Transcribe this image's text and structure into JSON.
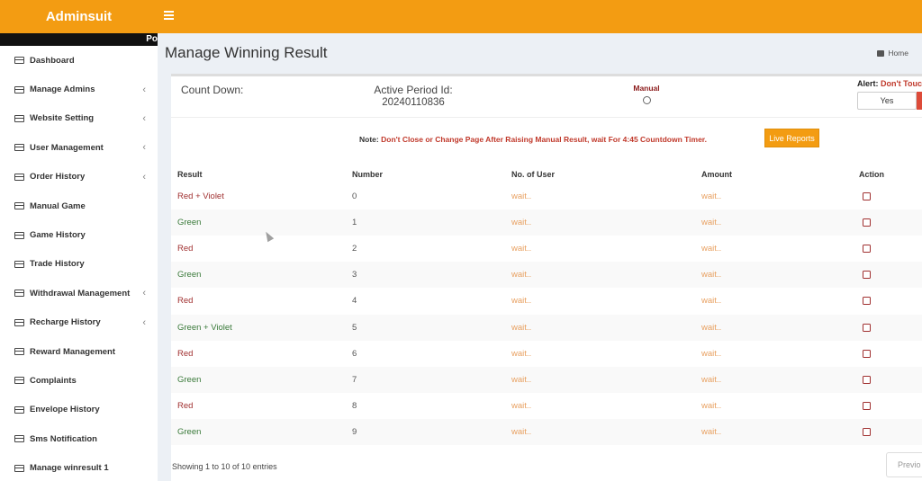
{
  "app": {
    "title": "Adminsuit",
    "sidebar_header_text": "Po"
  },
  "sidebar": {
    "items": [
      {
        "label": "Dashboard",
        "has_submenu": false
      },
      {
        "label": "Manage Admins",
        "has_submenu": true
      },
      {
        "label": "Website Setting",
        "has_submenu": true
      },
      {
        "label": "User Management",
        "has_submenu": true
      },
      {
        "label": "Order History",
        "has_submenu": true
      },
      {
        "label": "Manual Game",
        "has_submenu": false
      },
      {
        "label": "Game History",
        "has_submenu": false
      },
      {
        "label": "Trade History",
        "has_submenu": false
      },
      {
        "label": "Withdrawal Management",
        "has_submenu": true
      },
      {
        "label": "Recharge History",
        "has_submenu": true
      },
      {
        "label": "Reward Management",
        "has_submenu": false
      },
      {
        "label": "Complaints",
        "has_submenu": false
      },
      {
        "label": "Envelope History",
        "has_submenu": false
      },
      {
        "label": "Sms Notification",
        "has_submenu": false
      },
      {
        "label": "Manage winresult 1",
        "has_submenu": false
      }
    ]
  },
  "page": {
    "title": "Manage Winning Result",
    "breadcrumb_home": "Home"
  },
  "panel": {
    "count_down_label": "Count Down:",
    "active_period_label": "Active Period Id:",
    "active_period_value": "20240110836",
    "manual_label": "Manual",
    "alert_prefix": "Alert:",
    "alert_text": "Don't Touc",
    "yes_label": "Yes",
    "note_prefix": "Note:",
    "note_text": "Don't Close or Change Page After Raising Manual Result, wait For 4:45 Countdown Timer.",
    "live_reports_label": "Live Reports"
  },
  "table": {
    "headers": [
      "Result",
      "Number",
      "No. of User",
      "Amount",
      "Action"
    ],
    "rows": [
      {
        "result": "Red + Violet",
        "color": "red",
        "number": "0",
        "users": "wait..",
        "amount": "wait.."
      },
      {
        "result": "Green",
        "color": "green",
        "number": "1",
        "users": "wait..",
        "amount": "wait.."
      },
      {
        "result": "Red",
        "color": "red",
        "number": "2",
        "users": "wait..",
        "amount": "wait.."
      },
      {
        "result": "Green",
        "color": "green",
        "number": "3",
        "users": "wait..",
        "amount": "wait.."
      },
      {
        "result": "Red",
        "color": "red",
        "number": "4",
        "users": "wait..",
        "amount": "wait.."
      },
      {
        "result": "Green + Violet",
        "color": "green",
        "number": "5",
        "users": "wait..",
        "amount": "wait.."
      },
      {
        "result": "Red",
        "color": "red",
        "number": "6",
        "users": "wait..",
        "amount": "wait.."
      },
      {
        "result": "Green",
        "color": "green",
        "number": "7",
        "users": "wait..",
        "amount": "wait.."
      },
      {
        "result": "Red",
        "color": "red",
        "number": "8",
        "users": "wait..",
        "amount": "wait.."
      },
      {
        "result": "Green",
        "color": "green",
        "number": "9",
        "users": "wait..",
        "amount": "wait.."
      }
    ],
    "info": "Showing 1 to 10 of 10 entries",
    "prev_label": "Previo"
  },
  "colors": {
    "accent": "#f39c12",
    "red": "#a03030",
    "green": "#3a7a3a",
    "wait": "#e8a060"
  }
}
